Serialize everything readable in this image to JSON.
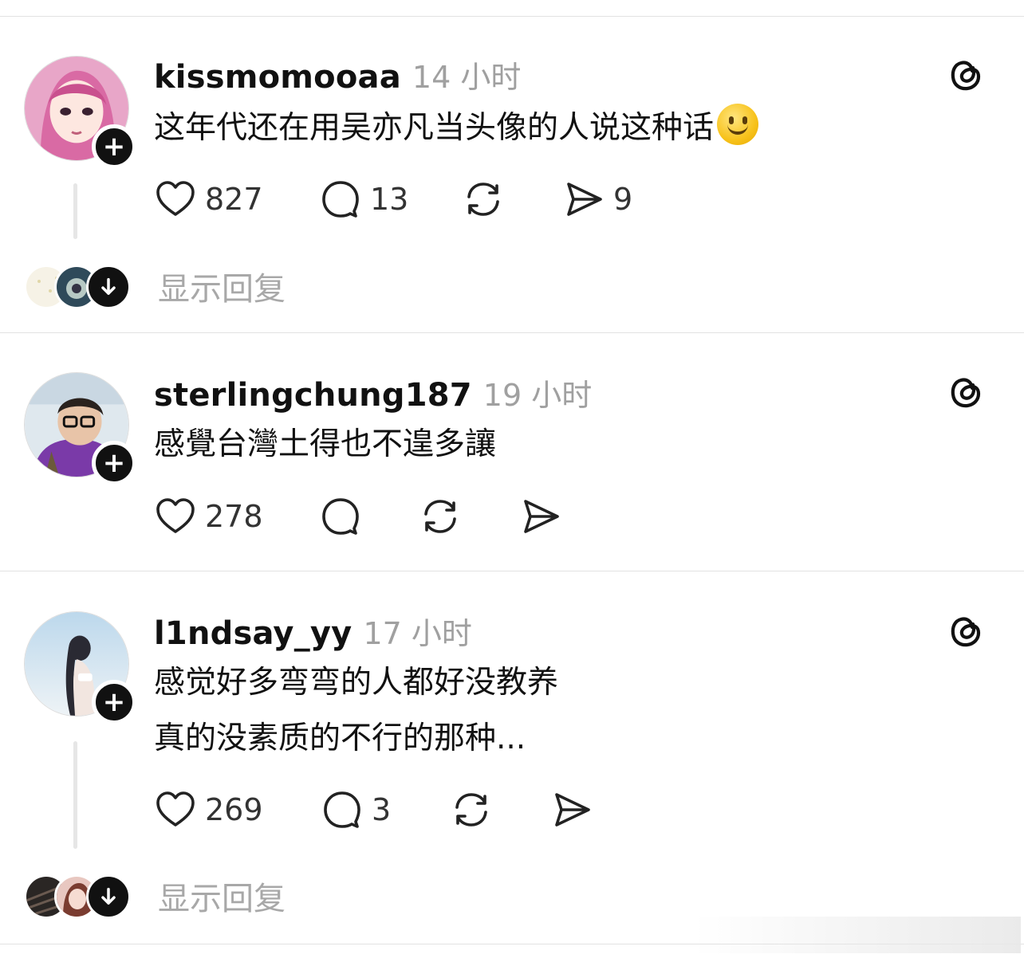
{
  "posts": [
    {
      "username": "kissmomooaa",
      "timestamp": "14 小时",
      "text_lines": [
        "这年代还在用吴亦凡当头像的人说这种话"
      ],
      "has_emoji": true,
      "likes": "827",
      "comments": "13",
      "reposts": "",
      "shares": "9",
      "show_replies": "显示回复"
    },
    {
      "username": "sterlingchung187",
      "timestamp": "19 小时",
      "text_lines": [
        "感覺台灣土得也不遑多讓"
      ],
      "likes": "278",
      "comments": "",
      "reposts": "",
      "shares": ""
    },
    {
      "username": "l1ndsay_yy",
      "timestamp": "17 小时",
      "text_lines": [
        "感觉好多弯弯的人都好没教养",
        "真的没素质的不行的那种..."
      ],
      "likes": "269",
      "comments": "3",
      "reposts": "",
      "shares": "",
      "show_replies": "显示回复"
    }
  ],
  "icons": {
    "threads": "threads-logo-icon",
    "like": "heart-icon",
    "comment": "comment-bubble-icon",
    "repost": "repost-icon",
    "share": "send-icon",
    "follow": "plus-icon",
    "expand": "arrow-down-icon"
  },
  "colors": {
    "text": "#111111",
    "muted": "#a0a0a0",
    "divider": "#e2e2e2",
    "button": "#111111"
  }
}
